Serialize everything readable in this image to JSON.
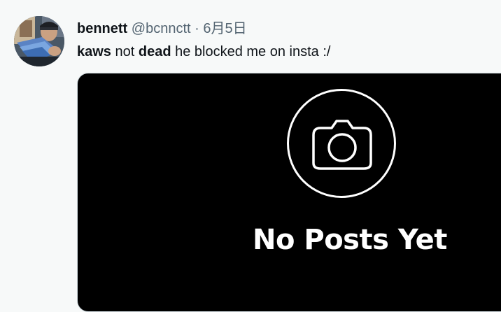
{
  "tweet": {
    "display_name": "bennett",
    "handle": "@bcnnctt",
    "separator": "·",
    "date": "6月5日",
    "text": {
      "part1": "kaws",
      "part2": " not ",
      "part3": "dead",
      "part4": " he blocked me on insta :/"
    }
  },
  "media": {
    "message": "No Posts Yet",
    "icon": "camera-icon"
  },
  "colors": {
    "background": "#f7f9f9",
    "text_primary": "#0f1419",
    "text_secondary": "#536471",
    "media_background": "#000000",
    "media_foreground": "#ffffff"
  }
}
